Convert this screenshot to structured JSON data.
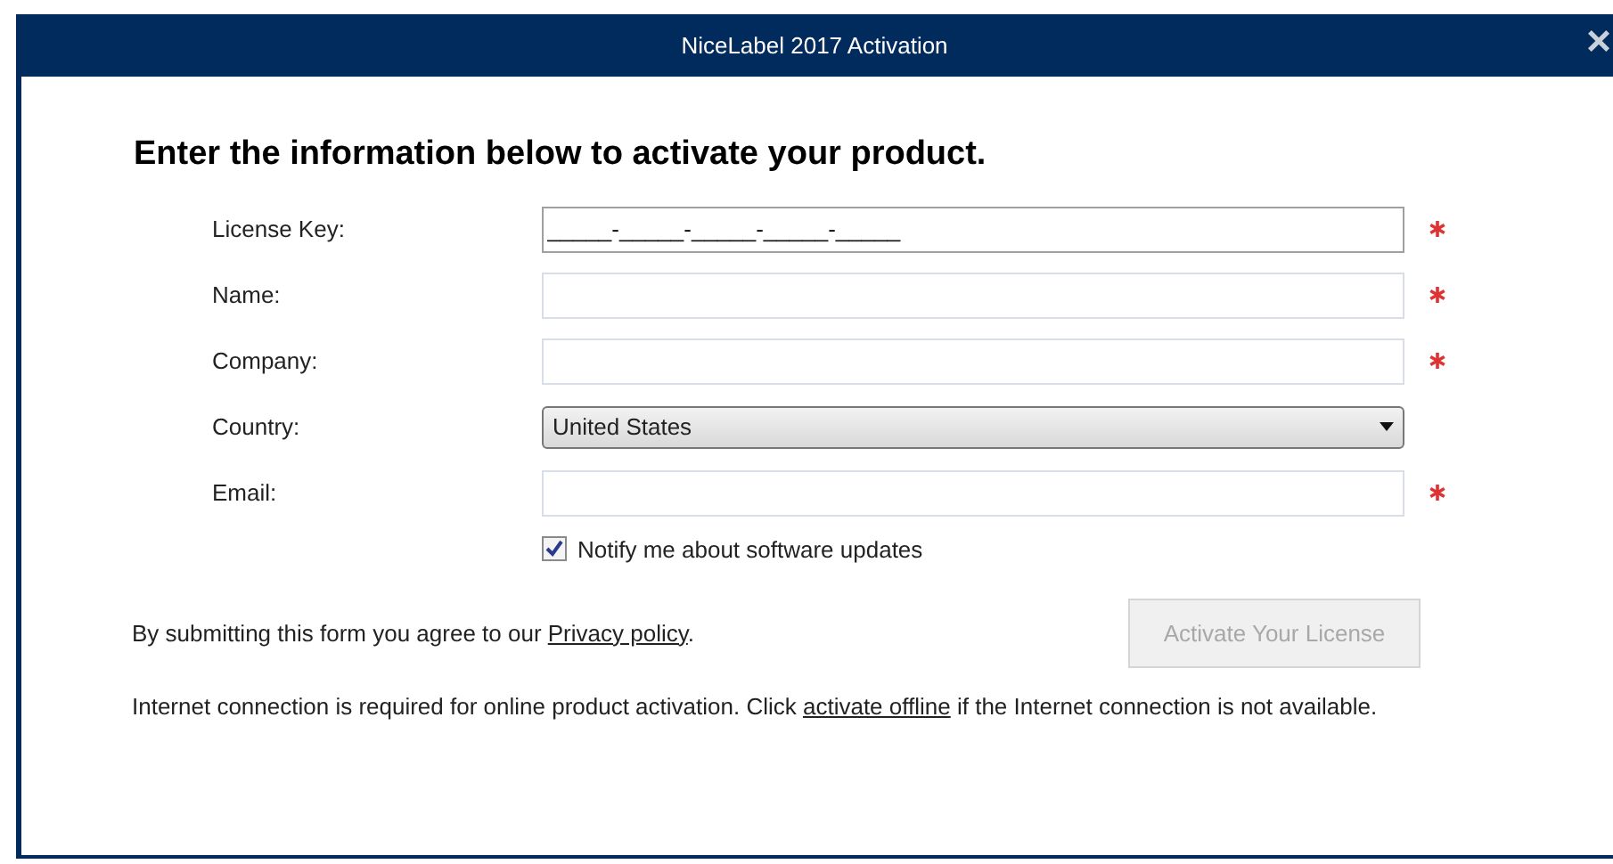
{
  "window": {
    "title": "NiceLabel 2017 Activation",
    "close": "×"
  },
  "heading": "Enter the information below to activate your product.",
  "fields": [
    {
      "kind": "text",
      "label": "License Key:",
      "value": "_____-_____-_____-_____-_____",
      "required": true
    },
    {
      "kind": "text",
      "label": "Name:",
      "required": true
    },
    {
      "kind": "text",
      "label": "Company:",
      "required": true
    },
    {
      "kind": "select",
      "label": "Country:",
      "value": "United States",
      "required": false
    },
    {
      "kind": "text",
      "label": "Email:",
      "required": true
    }
  ],
  "notify": {
    "label": "Notify me about software updates",
    "checked": true
  },
  "agreement": {
    "before": "By submitting this form you agree to our ",
    "link": "Privacy policy",
    "after": "."
  },
  "activate_button": {
    "label": "Activate Your License",
    "disabled": true
  },
  "note": {
    "before": "Internet connection is required for online product activation. Click ",
    "link": "activate offline",
    "after": " if the Internet connection is not available."
  }
}
